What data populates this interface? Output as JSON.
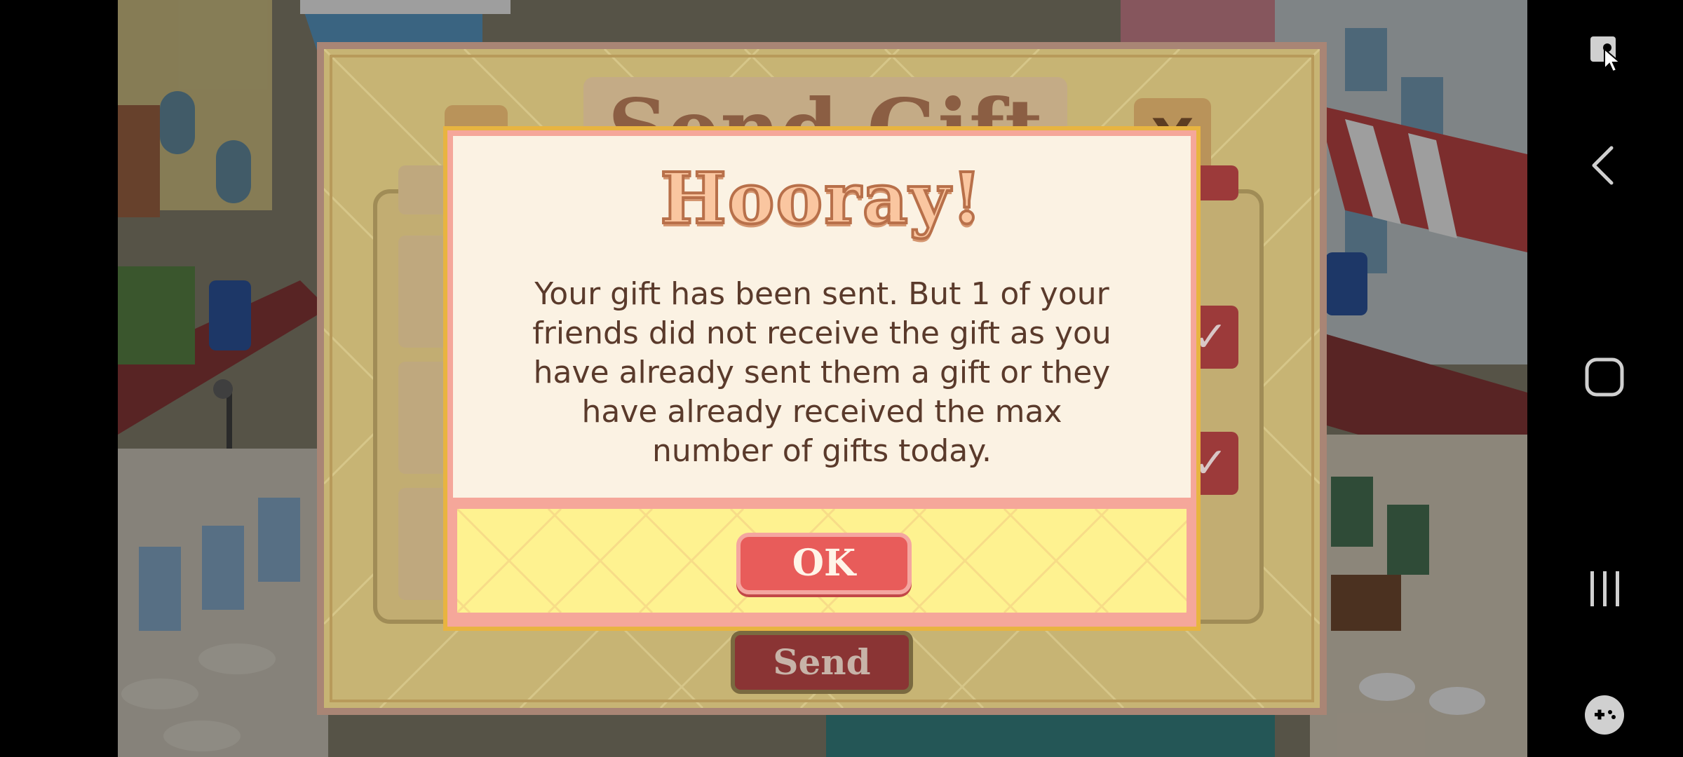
{
  "game": {
    "panel": {
      "title": "Send Gift",
      "close_label": "X",
      "send_label": "Send"
    },
    "dialog": {
      "title": "Hooray!",
      "message": "Your gift has been sent. But 1 of your friends did not receive the gift as you have already sent them a gift or they have already received the max number of gifts today.",
      "ok_label": "OK"
    }
  },
  "nav_bar": {
    "buttons": [
      {
        "name": "screen-capture-icon"
      },
      {
        "name": "back-icon"
      },
      {
        "name": "home-icon"
      },
      {
        "name": "recents-icon"
      },
      {
        "name": "game-tools-icon"
      }
    ]
  },
  "colors": {
    "dialog_body": "#fbf2e3",
    "dialog_footer": "#fef290",
    "ok_button": "#e85c5a",
    "title_stroke": "#b8704a",
    "message_text": "#5a3a2b"
  }
}
